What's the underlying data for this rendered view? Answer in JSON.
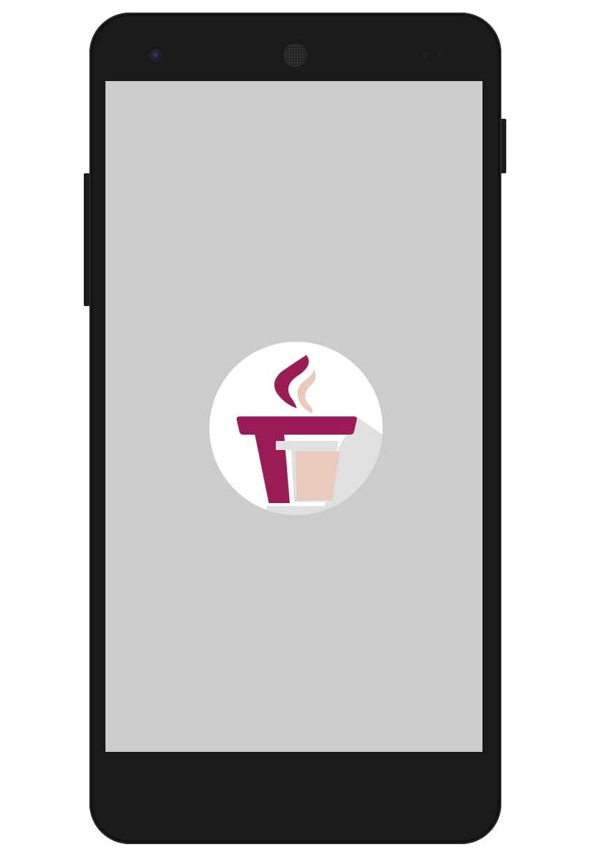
{
  "device": {
    "model": "smartphone",
    "frame_color": "#1a1a1a"
  },
  "screen": {
    "background_color": "#cccccc",
    "state": "splash"
  },
  "logo": {
    "icon": "coffee-cup-icon",
    "circle_color": "#ffffff",
    "cup_color": "#9b1b56",
    "accent_color": "#ebcabe",
    "shadow_color": "#e0e0e0"
  }
}
